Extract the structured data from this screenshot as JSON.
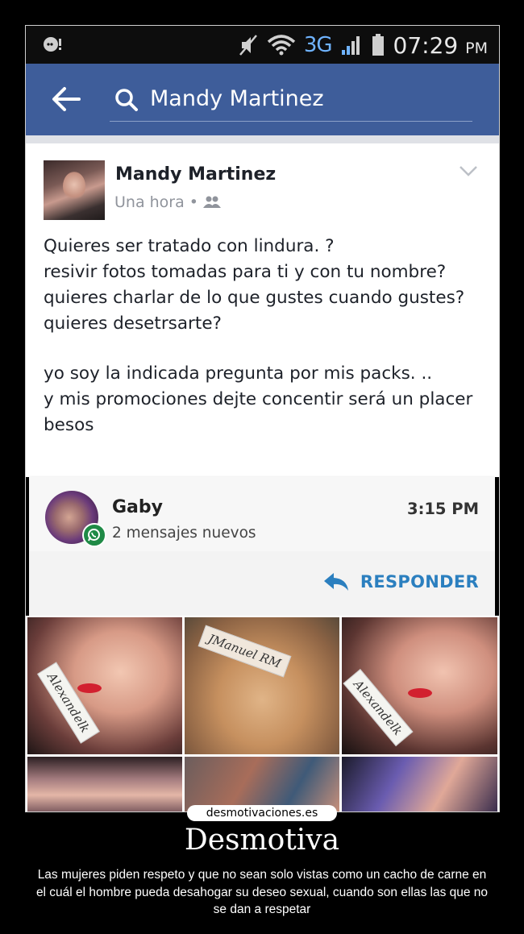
{
  "status_bar": {
    "network": "3G",
    "time": "07:29",
    "ampm": "PM"
  },
  "app_bar": {
    "search_value": "Mandy Martinez"
  },
  "post": {
    "author": "Mandy Martinez",
    "timestamp": "Una hora",
    "separator": "•",
    "body_lines_1": [
      "Quieres ser tratado con lindura. ?",
      "resivir fotos tomadas para ti y con tu nombre?",
      "quieres charlar de lo que gustes cuando gustes?",
      "quieres desetrsarte?"
    ],
    "body_lines_2": [
      "yo soy la indicada pregunta por mis packs. ..",
      "y mis promociones dejte concentir será un placer besos"
    ]
  },
  "notification": {
    "sender": "Gaby",
    "message": "2 mensajes nuevos",
    "time": "3:15 PM",
    "reply_label": "RESPONDER"
  },
  "photos": {
    "tag_1": "Alexandelk",
    "tag_2": "JManuel RM",
    "tag_3": "Alexandelk"
  },
  "watermark": "desmotivaciones.es",
  "footer": {
    "title": "Desmotiva",
    "caption": "Las mujeres piden respeto y que no sean solo vistas como un cacho de carne en el cuál el hombre pueda desahogar su deseo sexual, cuando son ellas las que no se dan a respetar"
  },
  "colors": {
    "app_bar": "#3e5d9a",
    "accent_reply": "#2b7fbf",
    "whatsapp": "#1f8a46"
  }
}
